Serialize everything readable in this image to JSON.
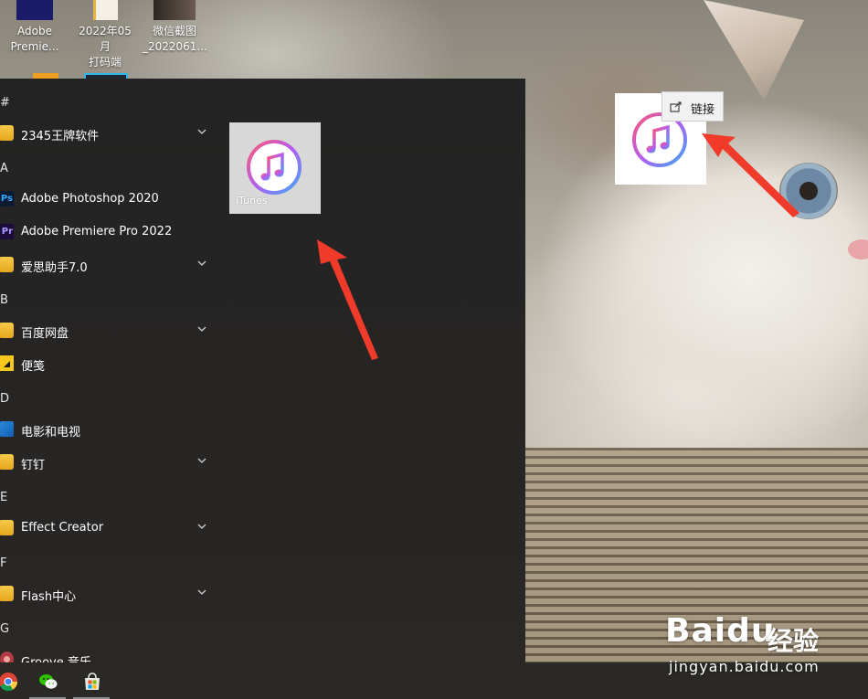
{
  "desktop": {
    "icons": [
      {
        "label_line1": "Adobe",
        "label_line2": "Premie..."
      },
      {
        "label_line1": "2022年05月",
        "label_line2": "打码端"
      },
      {
        "label_line1": "微信截图",
        "label_line2": "_2022061..."
      }
    ],
    "tooltip_label": "链接"
  },
  "start_menu": {
    "letters": [
      "#",
      "A",
      "B",
      "D",
      "E",
      "F",
      "G"
    ],
    "apps": [
      {
        "label": "2345王牌软件",
        "icon": "folder-icon",
        "expandable": true
      },
      {
        "label": "Adobe Photoshop 2020",
        "icon": "photoshop-icon",
        "icon_text": "Ps",
        "expandable": false
      },
      {
        "label": "Adobe Premiere Pro 2022",
        "icon": "premiere-icon",
        "icon_text": "Pr",
        "expandable": false
      },
      {
        "label": "爱思助手7.0",
        "icon": "folder-icon",
        "expandable": true
      },
      {
        "label": "百度网盘",
        "icon": "folder-icon",
        "expandable": true
      },
      {
        "label": "便笺",
        "icon": "sticky-notes-icon",
        "expandable": false
      },
      {
        "label": "电影和电视",
        "icon": "movies-tv-icon",
        "expandable": false
      },
      {
        "label": "钉钉",
        "icon": "folder-icon",
        "expandable": true
      },
      {
        "label": "Effect Creator",
        "icon": "folder-icon",
        "expandable": true
      },
      {
        "label": "Flash中心",
        "icon": "folder-icon",
        "expandable": true
      },
      {
        "label": "Groove 音乐",
        "icon": "groove-music-icon",
        "expandable": false
      }
    ],
    "tile": {
      "label": "iTunes",
      "icon": "itunes-icon"
    }
  },
  "taskbar": {
    "items": [
      {
        "name": "chrome-icon"
      },
      {
        "name": "wechat-icon"
      },
      {
        "name": "microsoft-store-icon"
      }
    ]
  },
  "watermark": {
    "logo_text": "Baidu",
    "text": "经验",
    "url": "jingyan.baidu.com"
  },
  "colors": {
    "start_menu_bg": "#232323",
    "folder": "#f7c948",
    "annotation_arrow": "#f03a2a",
    "taskbar_bg": "#2b2926"
  }
}
